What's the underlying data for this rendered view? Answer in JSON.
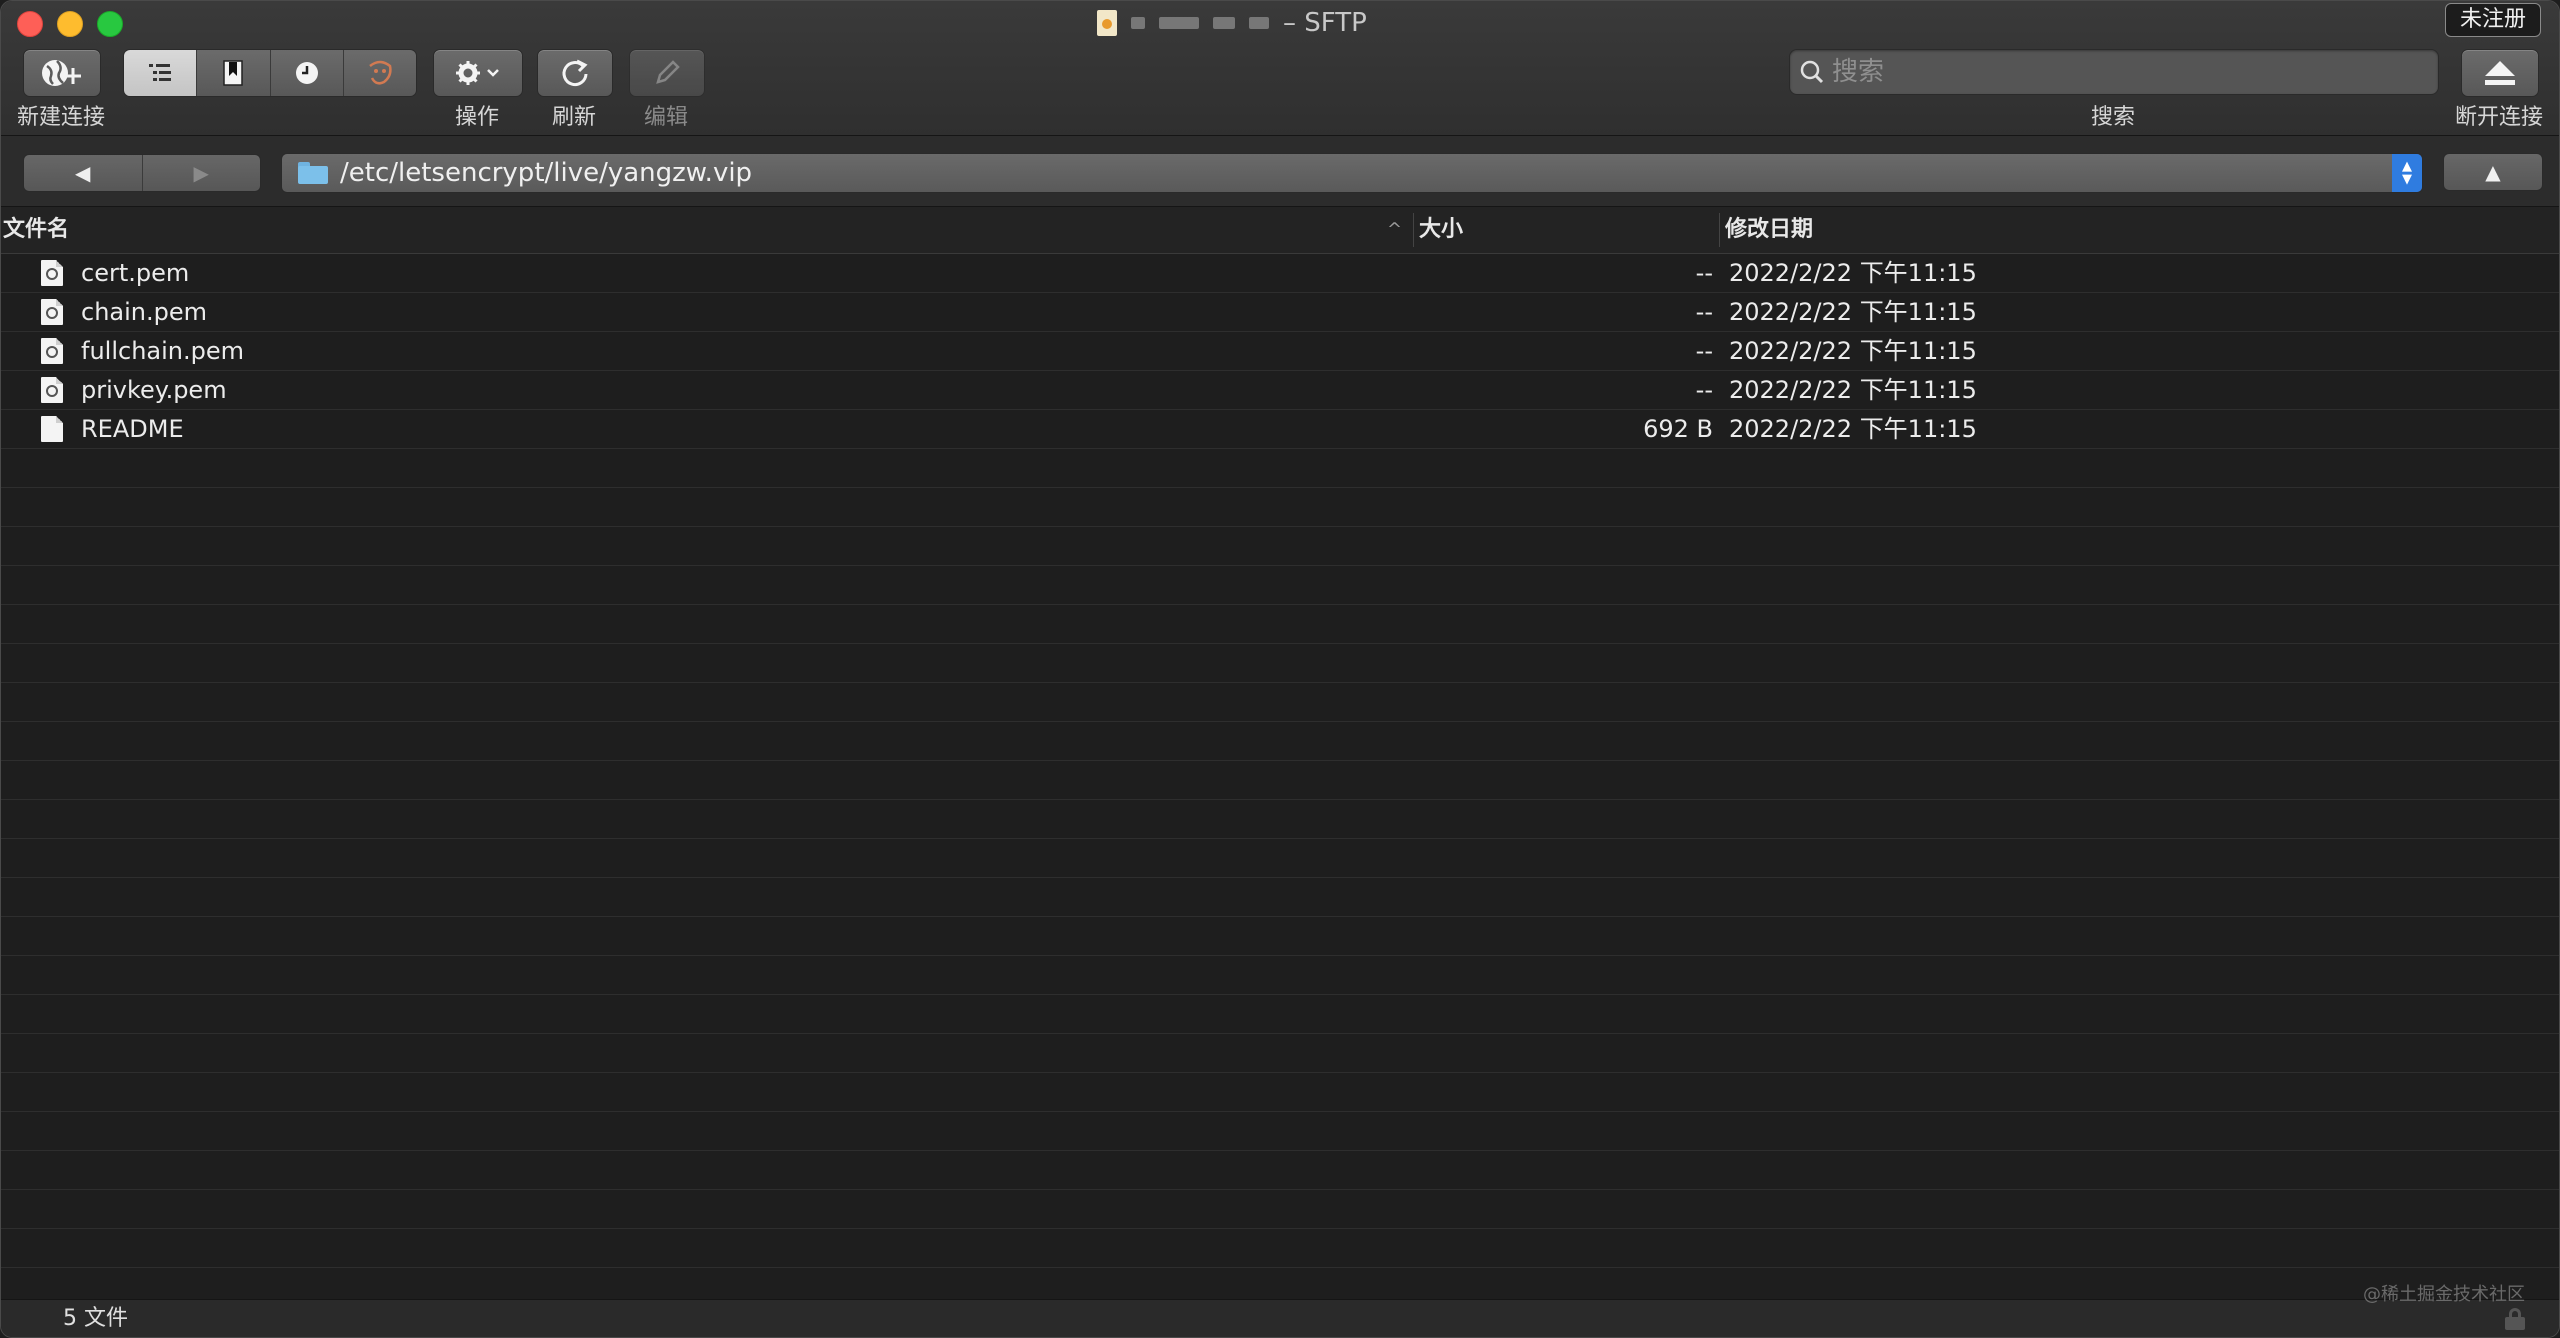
{
  "window": {
    "title": "– SFTP",
    "register_label": "未注册"
  },
  "toolbar": {
    "new_connection_label": "新建连接",
    "action_label": "操作",
    "refresh_label": "刷新",
    "edit_label": "编辑",
    "search_label": "搜索",
    "search_placeholder": "搜索",
    "disconnect_label": "断开连接",
    "view_modes": [
      "browser",
      "bookmarks",
      "history",
      "bonjour"
    ],
    "active_view": "browser"
  },
  "pathbar": {
    "path": "/etc/letsencrypt/live/yangzw.vip"
  },
  "table": {
    "columns": {
      "name": "文件名",
      "size": "大小",
      "modified": "修改日期"
    },
    "rows": [
      {
        "name": "cert.pem",
        "size": "--",
        "modified": "2022/2/22 下午11:15",
        "icon": "certificate-file-icon"
      },
      {
        "name": "chain.pem",
        "size": "--",
        "modified": "2022/2/22 下午11:15",
        "icon": "certificate-file-icon"
      },
      {
        "name": "fullchain.pem",
        "size": "--",
        "modified": "2022/2/22 下午11:15",
        "icon": "certificate-file-icon"
      },
      {
        "name": "privkey.pem",
        "size": "--",
        "modified": "2022/2/22 下午11:15",
        "icon": "certificate-file-icon"
      },
      {
        "name": "README",
        "size": "692 B",
        "modified": "2022/2/22 下午11:15",
        "icon": "document-file-icon"
      }
    ]
  },
  "status": {
    "count": "5 文件",
    "watermark": "@稀土掘金技术社区"
  },
  "colors": {
    "close": "#fe5f57",
    "minimize": "#febc2e",
    "maximize": "#28c840",
    "stepper": "#2f7ce0",
    "folder": "#7cc0ea"
  }
}
